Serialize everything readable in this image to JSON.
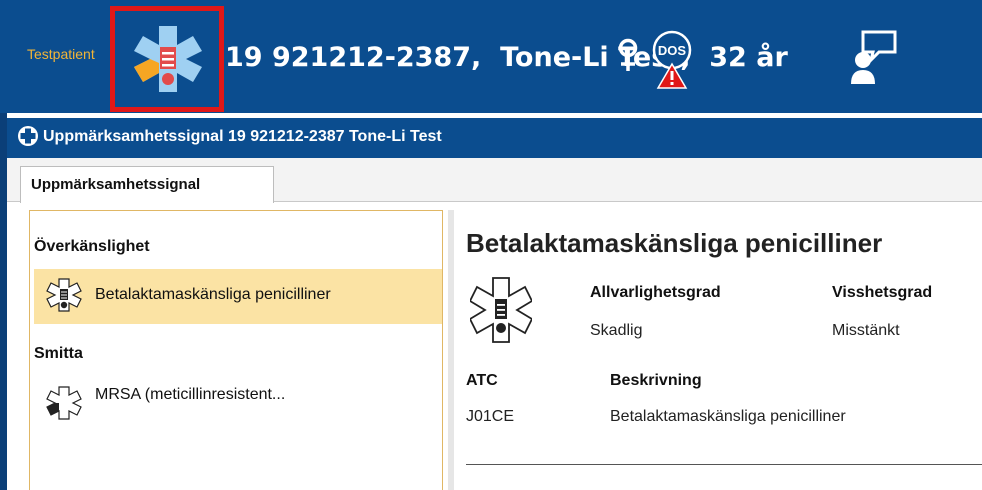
{
  "header": {
    "badge": "Testpatient",
    "patient_line": "19 921212-2387,  Tone-Li Test,  32 år",
    "icons": [
      "alert-signal-icon",
      "female-icon",
      "dos-warning-icon",
      "chat-user-icon"
    ],
    "colors": {
      "header_bg": "#0b4d8f",
      "badge_text": "#f2b537",
      "highlight_border": "#e01818"
    }
  },
  "window": {
    "title": "Uppmärksamhetssignal 19 921212-2387 Tone-Li Test"
  },
  "tabs": [
    {
      "label": "Uppmärksamhetssignal",
      "active": true
    }
  ],
  "list": {
    "groups": [
      {
        "heading": "Överkänslighet",
        "items": [
          {
            "label": "Betalaktamaskänsliga penicilliner",
            "selected": true
          }
        ]
      },
      {
        "heading": "Smitta",
        "items": [
          {
            "label": "MRSA (meticillinresistent...",
            "selected": false
          }
        ]
      }
    ],
    "selected_color": "#fbe3a4"
  },
  "detail": {
    "title": "Betalaktamaskänsliga penicilliner",
    "severity_label": "Allvarlighetsgrad",
    "severity_value": "Skadlig",
    "certainty_label": "Visshetsgrad",
    "certainty_value": "Misstänkt",
    "atc_label": "ATC",
    "atc_value": "J01CE",
    "description_label": "Beskrivning",
    "description_value": "Betalaktamaskänsliga penicilliner"
  }
}
